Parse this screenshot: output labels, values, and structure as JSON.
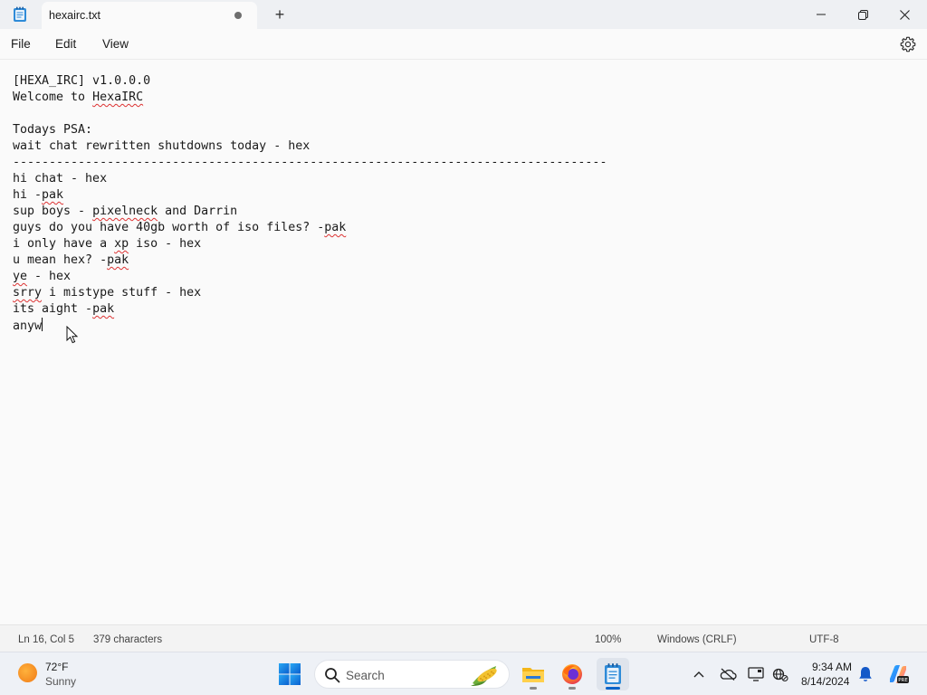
{
  "window": {
    "tab_title": "hexairc.txt",
    "new_tab_symbol": "+",
    "icons": [
      "notepad-icon",
      "unsaved-dot-icon",
      "minimize-icon",
      "maximize-icon",
      "close-icon"
    ]
  },
  "menu": {
    "file": "File",
    "edit": "Edit",
    "view": "View",
    "settings_icon": "gear-icon"
  },
  "editor": {
    "lines": [
      "[HEXA_IRC] v1.0.0.0",
      "Welcome to ",
      "HexaIRC",
      "",
      "Todays PSA:",
      "wait chat rewritten shutdowns today - hex",
      "----------------------------------------------------------------------------------",
      "hi chat - hex",
      "hi -",
      "pak",
      "sup boys - ",
      "pixelneck",
      " and Darrin",
      "guys do you have 40gb worth of iso files? -",
      "pak",
      "i only have a ",
      "xp",
      " iso - hex",
      "u mean hex? -",
      "pak",
      "ye",
      " - hex",
      "srry",
      " i mistype stuff - hex",
      "its aight -",
      "pak",
      "anyw"
    ]
  },
  "status": {
    "position": "Ln 16, Col 5",
    "characters": "379 characters",
    "zoom": "100%",
    "line_ending": "Windows (CRLF)",
    "encoding": "UTF-8"
  },
  "taskbar": {
    "weather_temp": "72°F",
    "weather_desc": "Sunny",
    "search_placeholder": "Search",
    "apps": [
      "windows-start-icon",
      "file-explorer-icon",
      "firefox-icon",
      "notepad-icon"
    ],
    "time": "9:34 AM",
    "date": "8/14/2024",
    "tray_icons": [
      "chevron-up-icon",
      "onedrive-icon",
      "display-icon",
      "network-icon",
      "bell-icon",
      "copilot-icon"
    ]
  }
}
